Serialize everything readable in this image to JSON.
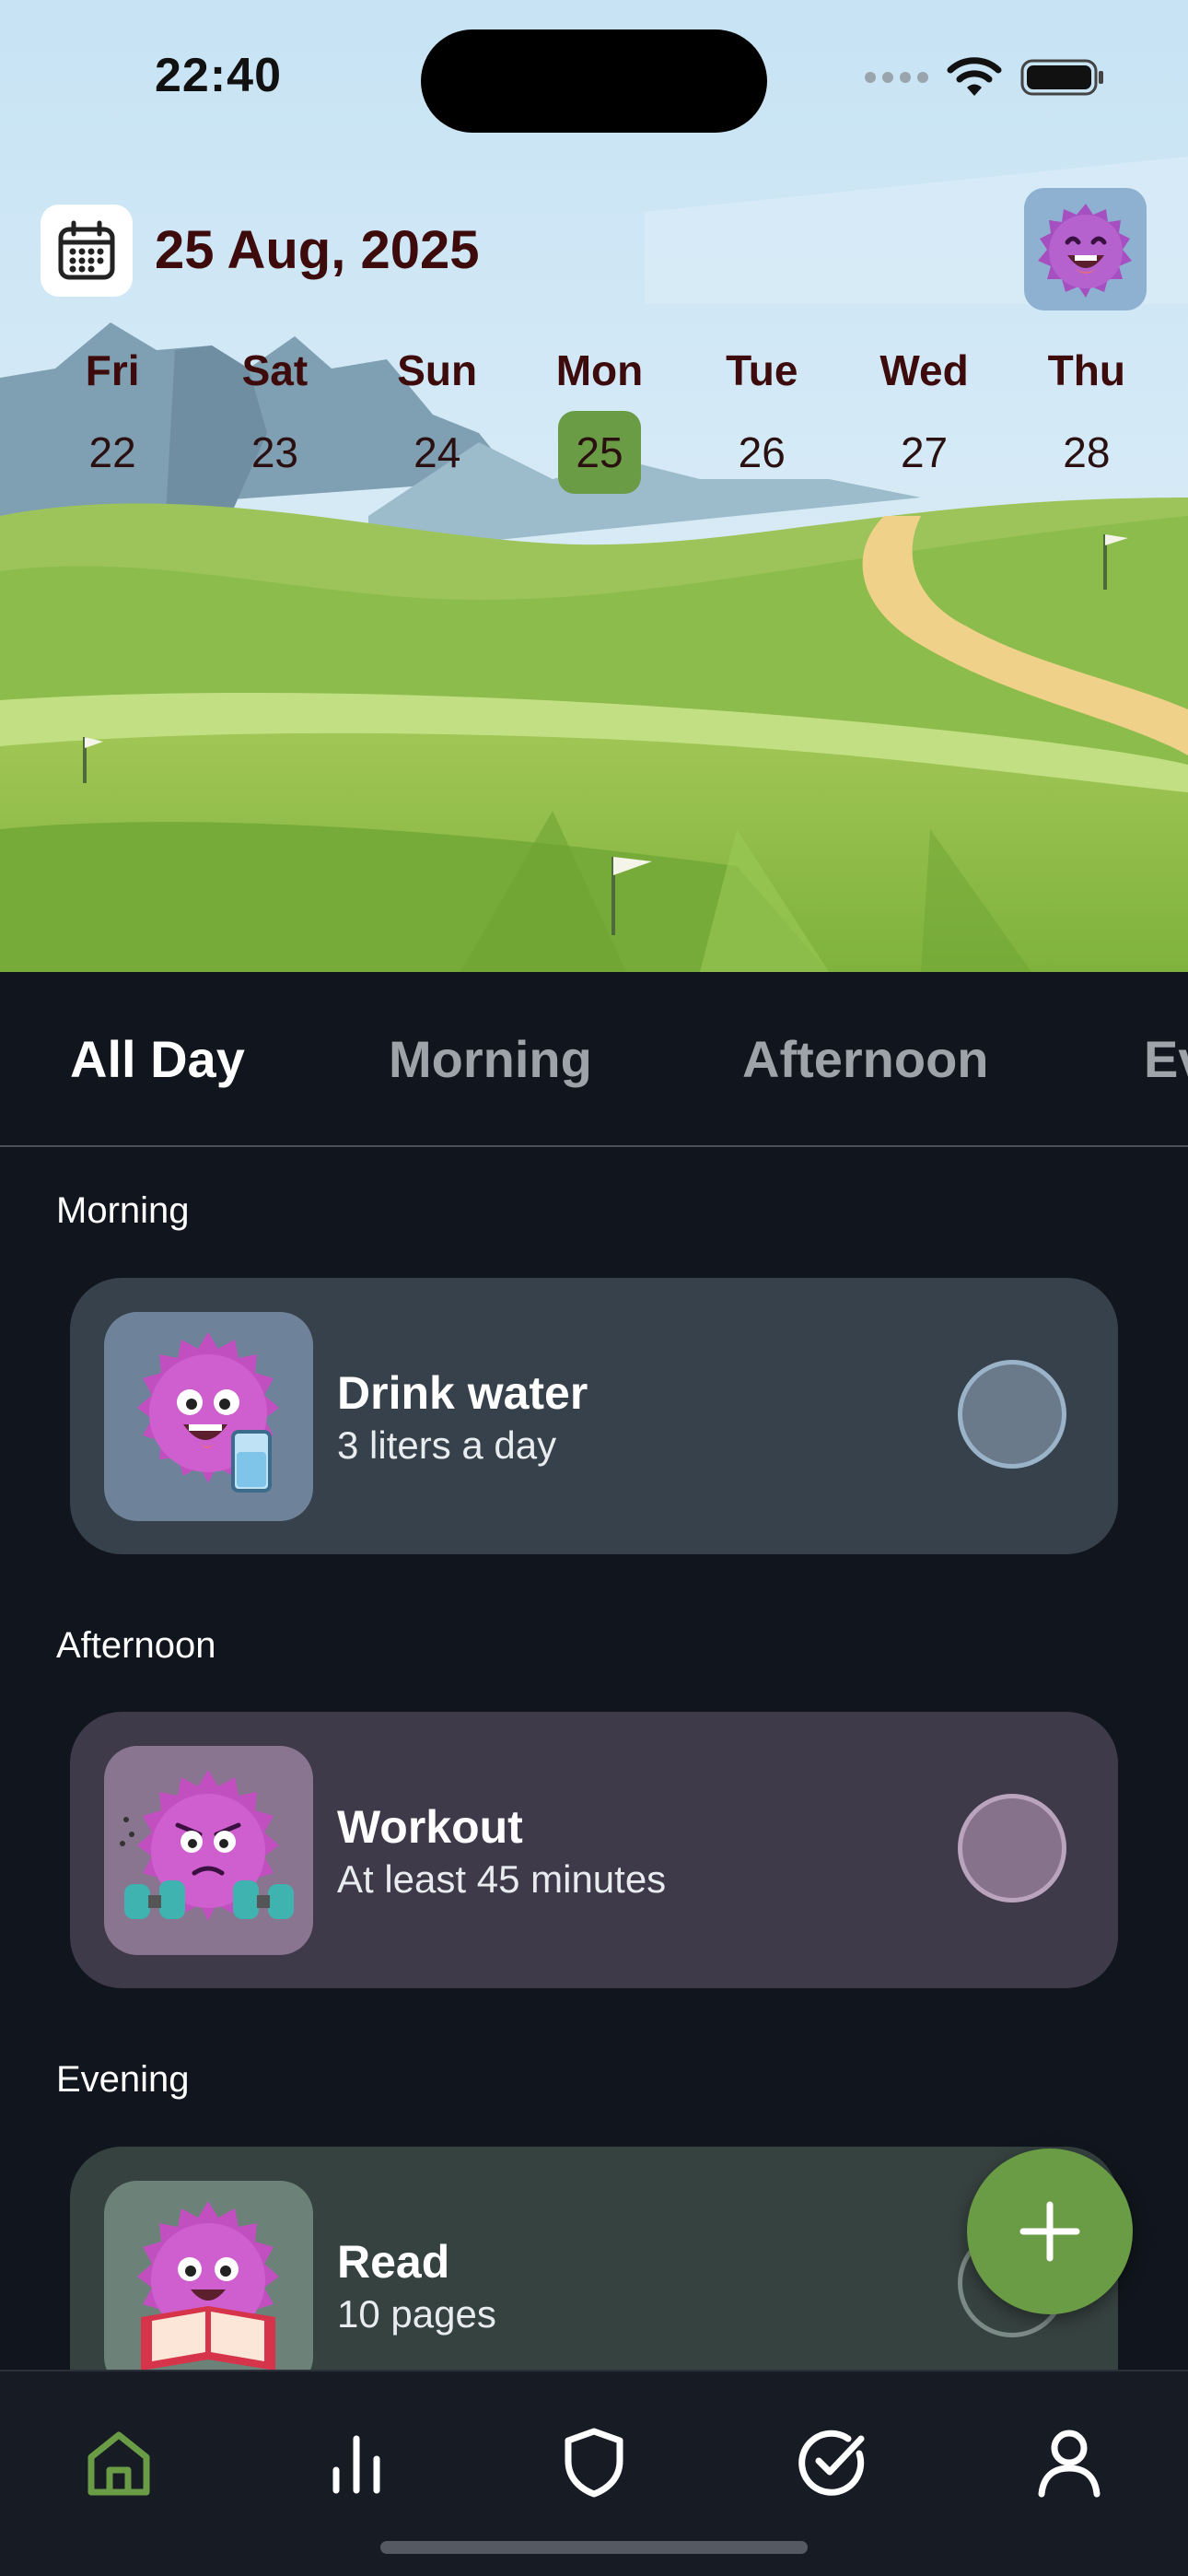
{
  "status_bar": {
    "time": "22:40"
  },
  "header": {
    "date": "25 Aug, 2025",
    "week": [
      {
        "day": "Fri",
        "num": "22",
        "selected": false
      },
      {
        "day": "Sat",
        "num": "23",
        "selected": false
      },
      {
        "day": "Sun",
        "num": "24",
        "selected": false
      },
      {
        "day": "Mon",
        "num": "25",
        "selected": true
      },
      {
        "day": "Tue",
        "num": "26",
        "selected": false
      },
      {
        "day": "Wed",
        "num": "27",
        "selected": false
      },
      {
        "day": "Thu",
        "num": "28",
        "selected": false
      }
    ]
  },
  "tabs": [
    {
      "label": "All Day",
      "active": true
    },
    {
      "label": "Morning",
      "active": false
    },
    {
      "label": "Afternoon",
      "active": false
    },
    {
      "label": "Evening",
      "active": false
    }
  ],
  "sections": [
    {
      "title": "Morning",
      "habit": {
        "title": "Drink water",
        "subtitle": "3 liters a day",
        "icon": "monster-water-icon",
        "card_color": "#37414b",
        "done": false
      }
    },
    {
      "title": "Afternoon",
      "habit": {
        "title": "Workout",
        "subtitle": "At least 45 minutes",
        "icon": "monster-dumbbell-icon",
        "card_color": "#3e3a49",
        "done": false
      }
    },
    {
      "title": "Evening",
      "habit": {
        "title": "Read",
        "subtitle": "10 pages",
        "icon": "monster-book-icon",
        "card_color": "#364240",
        "done": false
      }
    }
  ],
  "fab": {
    "icon": "plus-icon"
  },
  "tabbar": [
    {
      "name": "home",
      "icon": "home-icon",
      "active": true
    },
    {
      "name": "stats",
      "icon": "bar-chart-icon",
      "active": false
    },
    {
      "name": "shield",
      "icon": "shield-icon",
      "active": false
    },
    {
      "name": "checks",
      "icon": "check-circle-icon",
      "active": false
    },
    {
      "name": "profile",
      "icon": "person-icon",
      "active": false
    }
  ],
  "colors": {
    "accent": "#6a9b45",
    "background": "#11151d",
    "header_text": "#3d0b0b"
  }
}
